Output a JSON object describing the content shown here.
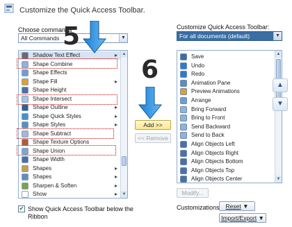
{
  "header": {
    "title": "Customize the Quick Access Toolbar."
  },
  "left": {
    "choose_label": "Choose commands",
    "choose_value": "All Commands",
    "items": [
      {
        "label": "Shadow Text Effect",
        "icon": "shadow-text-icon",
        "color": "#6b6b6b",
        "chevron": true
      },
      {
        "label": "Shape Combine",
        "icon": "shape-combine-icon",
        "color": "#8fb3d9",
        "chevron": false
      },
      {
        "label": "Shape Effects",
        "icon": "shape-effects-icon",
        "color": "#6aa0d8",
        "chevron": false
      },
      {
        "label": "Shape Fill",
        "icon": "shape-fill-icon",
        "color": "#e0a030",
        "chevron": true
      },
      {
        "label": "Shape Height",
        "icon": "shape-height-icon",
        "color": "#4b6fa8",
        "chevron": false
      },
      {
        "label": "Shape Intersect",
        "icon": "shape-intersect-icon",
        "color": "#a7c4e2",
        "chevron": false
      },
      {
        "label": "Shape Outline",
        "icon": "shape-outline-icon",
        "color": "#2f5f9b",
        "chevron": true
      },
      {
        "label": "Shape Quick Styles",
        "icon": "shape-quick-styles-icon",
        "color": "#4a90c8",
        "chevron": true
      },
      {
        "label": "Shape Styles",
        "icon": "shape-styles-icon",
        "color": "#5c8fc0",
        "chevron": true
      },
      {
        "label": "Shape Subtract",
        "icon": "shape-subtract-icon",
        "color": "#9fb9d6",
        "chevron": false
      },
      {
        "label": "Shape Texture Options",
        "icon": "shape-texture-icon",
        "color": "#b55a2e",
        "chevron": false
      },
      {
        "label": "Shape Union",
        "icon": "shape-union-icon",
        "color": "#7fa6d1",
        "chevron": false
      },
      {
        "label": "Shape Width",
        "icon": "shape-width-icon",
        "color": "#4b6fa8",
        "chevron": false
      },
      {
        "label": "Shapes",
        "icon": "shapes-icon",
        "color": "#c8a04a",
        "chevron": true
      },
      {
        "label": "Shapes",
        "icon": "shapes-icon",
        "color": "#5c8fc0",
        "chevron": true
      },
      {
        "label": "Sharpen & Soften",
        "icon": "sharpen-icon",
        "color": "#7aa34a",
        "chevron": true
      },
      {
        "label": "Show",
        "icon": "show-icon",
        "color": "#ffffff",
        "chevron": true
      }
    ],
    "show_below_label": "Show Quick Access Toolbar below the",
    "show_below_label2": "Ribbon"
  },
  "middle": {
    "add_label": "Add >>",
    "remove_label": "<< Remove",
    "step5": "5",
    "step6": "6"
  },
  "right": {
    "customize_label": "Customize Quick Access Toolbar:",
    "customize_value": "For all documents (default)",
    "items": [
      {
        "label": "Save",
        "icon": "save-icon",
        "color": "#3a6ea5"
      },
      {
        "label": "Undo",
        "icon": "undo-icon",
        "color": "#2e7bd0"
      },
      {
        "label": "Redo",
        "icon": "redo-icon",
        "color": "#2e7bd0"
      },
      {
        "label": "Animation Pane",
        "icon": "animation-pane-icon",
        "color": "#5c8fc0"
      },
      {
        "label": "Preview Animations",
        "icon": "preview-animations-icon",
        "color": "#e0a030"
      },
      {
        "label": "Arrange",
        "icon": "arrange-icon",
        "color": "#6aa0d8"
      },
      {
        "label": "Bring Forward",
        "icon": "bring-forward-icon",
        "color": "#8fb3d9"
      },
      {
        "label": "Bring to Front",
        "icon": "bring-to-front-icon",
        "color": "#8fb3d9"
      },
      {
        "label": "Send Backward",
        "icon": "send-backward-icon",
        "color": "#8fb3d9"
      },
      {
        "label": "Send to Back",
        "icon": "send-to-back-icon",
        "color": "#8fb3d9"
      },
      {
        "label": "Align Objects Left",
        "icon": "align-left-icon",
        "color": "#4b6fa8"
      },
      {
        "label": "Align Objects Right",
        "icon": "align-right-icon",
        "color": "#4b6fa8"
      },
      {
        "label": "Align Objects Bottom",
        "icon": "align-bottom-icon",
        "color": "#4b6fa8"
      },
      {
        "label": "Align Objects Top",
        "icon": "align-top-icon",
        "color": "#4b6fa8"
      },
      {
        "label": "Align Objects Center",
        "icon": "align-center-icon",
        "color": "#4b6fa8"
      }
    ],
    "modify_label": "Modify...",
    "customizations_label": "Customizations:",
    "reset_label": "Reset",
    "import_export_label": "Import/Export"
  }
}
